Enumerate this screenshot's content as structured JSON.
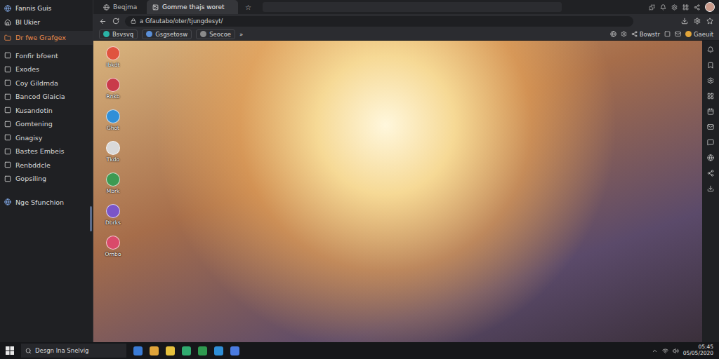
{
  "sidebar": {
    "app_title": "Fannis Guis",
    "back_label": "Bl Ukier",
    "items": [
      {
        "label": "Dr fwe Grafgex",
        "selected": true
      },
      {
        "label": "Fonfir bfoent",
        "selected": false
      },
      {
        "label": "Exodes",
        "selected": false
      },
      {
        "label": "Coy Gildmda",
        "selected": false
      },
      {
        "label": "Bancod Glaicia",
        "selected": false
      },
      {
        "label": "Kusandotin",
        "selected": false
      },
      {
        "label": "Gomtening",
        "selected": false
      },
      {
        "label": "Gnagisy",
        "selected": false
      },
      {
        "label": "Bastes Embeis",
        "selected": false
      },
      {
        "label": "Renbddcle",
        "selected": false
      },
      {
        "label": "Gopsiling",
        "selected": false
      }
    ],
    "footer": "Nge Sfunchion"
  },
  "tabs": [
    {
      "label": "Beqjma",
      "selected": false
    },
    {
      "label": "Gomme thajs woret",
      "selected": true
    }
  ],
  "new_tab": "☆",
  "address": "a Gfautabo/oter/tjungdesyt/",
  "bookmarks": [
    "Bsvsvq",
    "Gsgsetosw",
    "Seocoe"
  ],
  "bookmarks_more": "»",
  "toolbar_buttons": [
    "Bowstr",
    "Gaeuit"
  ],
  "desktop_icons": [
    {
      "label": "Ibkdt",
      "color": "#e0533f"
    },
    {
      "label": "Rnkb",
      "color": "#c93a4a"
    },
    {
      "label": "Ghot",
      "color": "#2f8fd8"
    },
    {
      "label": "Tkdo",
      "color": "#d9d9d9"
    },
    {
      "label": "Mbrk",
      "color": "#3c9a52"
    },
    {
      "label": "Dbrks",
      "color": "#7a55c8"
    },
    {
      "label": "Ornbo",
      "color": "#d94a6a"
    }
  ],
  "taskbar": {
    "search": "Desgn lna Snelvig",
    "time": "05:45",
    "date": "05/05/2020"
  }
}
